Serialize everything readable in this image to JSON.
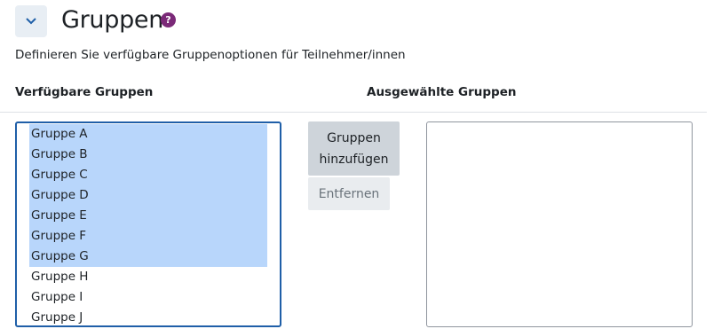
{
  "section": {
    "title": "Gruppen",
    "help_symbol": "?",
    "description": "Definieren Sie verfügbare Gruppenoptionen für Teilnehmer/innen",
    "collapse_icon": "chevron-down-icon"
  },
  "available": {
    "label": "Verfügbare Gruppen",
    "options": [
      {
        "text": "Gruppe A",
        "selected": true
      },
      {
        "text": "Gruppe B",
        "selected": true
      },
      {
        "text": "Gruppe C",
        "selected": true
      },
      {
        "text": "Gruppe D",
        "selected": true
      },
      {
        "text": "Gruppe E",
        "selected": true
      },
      {
        "text": "Gruppe F",
        "selected": true
      },
      {
        "text": "Gruppe G",
        "selected": true
      },
      {
        "text": "Gruppe H",
        "selected": false
      },
      {
        "text": "Gruppe I",
        "selected": false
      },
      {
        "text": "Gruppe J",
        "selected": false
      }
    ]
  },
  "selected_groups": {
    "label": "Ausgewählte Gruppen",
    "options": []
  },
  "actions": {
    "add_line1": "Gruppen",
    "add_line2": "hinzufügen",
    "remove": "Entfernen"
  },
  "colors": {
    "accent": "#1f5fa8",
    "highlight": "#b8d6fb",
    "help": "#7b2a78"
  }
}
